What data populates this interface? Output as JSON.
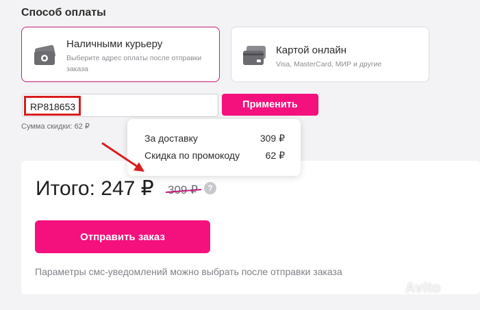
{
  "section_title": "Способ оплаты",
  "payment_options": [
    {
      "title": "Наличными курьеру",
      "description": "Выберите адрес оплаты после отправки заказа",
      "selected": true,
      "icon": "cash-icon"
    },
    {
      "title": "Картой онлайн",
      "description": "Visa, MasterCard, МИР и другие",
      "selected": false,
      "icon": "card-icon"
    }
  ],
  "promo": {
    "value": "RP818653",
    "apply_label": "Применить",
    "discount_sum": "Сумма скидки: 62 ₽"
  },
  "tooltip": {
    "rows": [
      {
        "label": "За доставку",
        "amount": "309 ₽"
      },
      {
        "label": "Скидка по промокоду",
        "amount": "62 ₽"
      }
    ]
  },
  "summary": {
    "total": "Итого: 247 ₽",
    "old_price": "309 ₽",
    "help": "?",
    "submit_label": "Отправить заказ",
    "sms_note": "Параметры смс-уведомлений можно выбрать после отправки заказа"
  },
  "watermark": "Avito",
  "colors": {
    "accent": "#f4117e",
    "annotation": "#d91c1c"
  }
}
